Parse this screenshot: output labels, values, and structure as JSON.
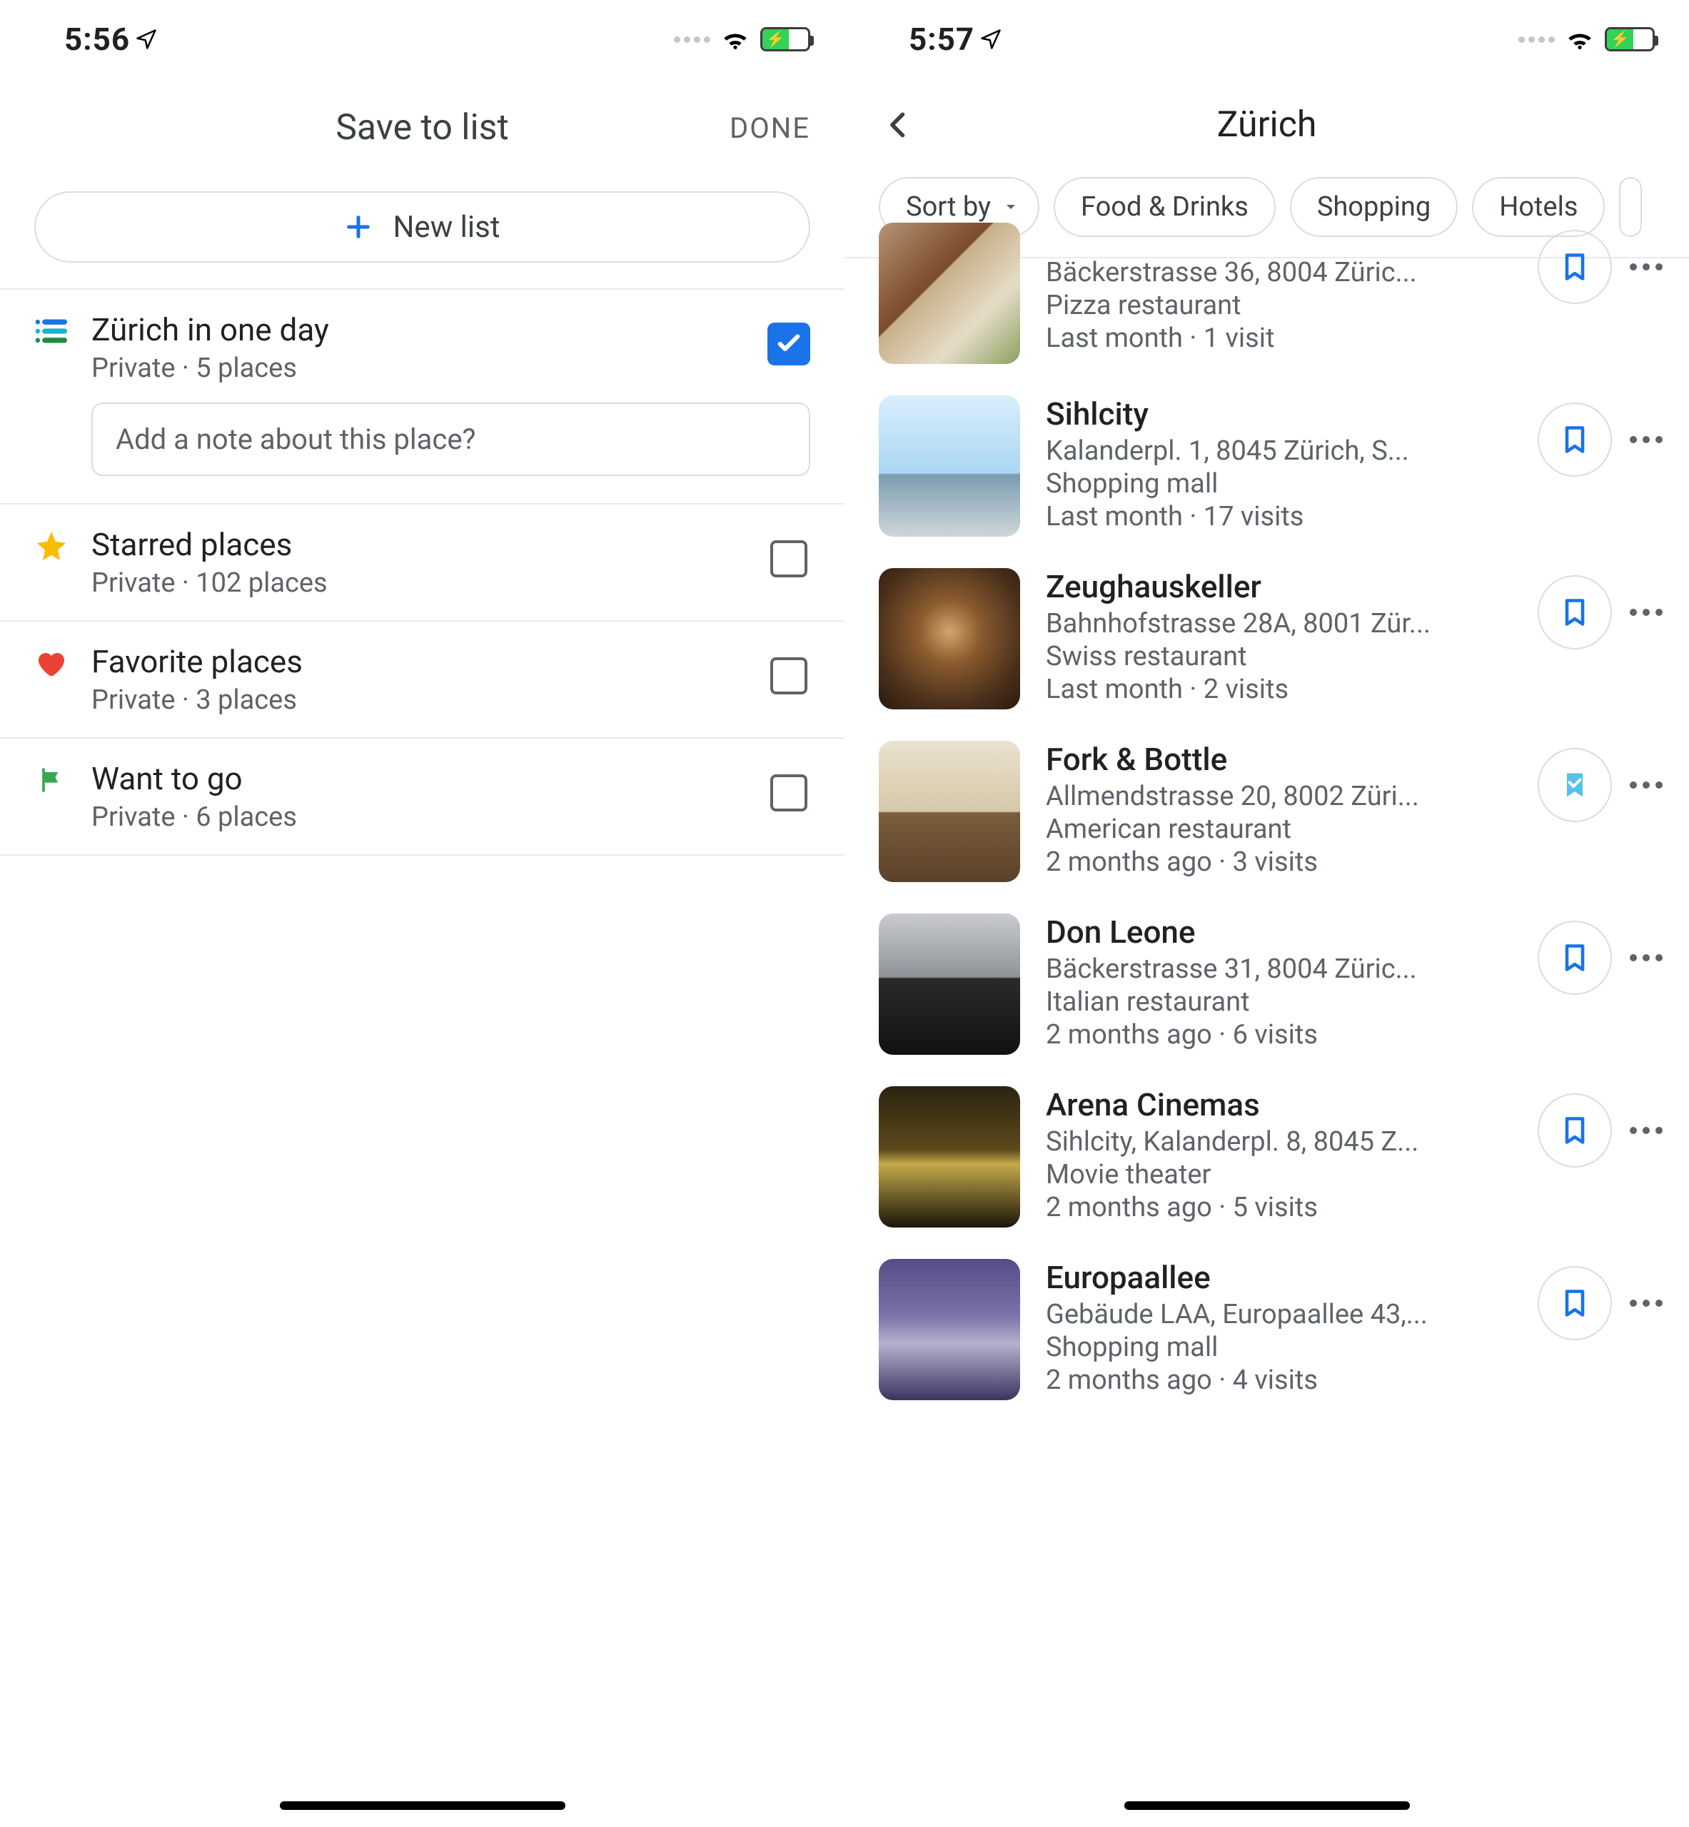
{
  "left": {
    "status": {
      "time": "5:56"
    },
    "header": {
      "title": "Save to list",
      "done": "DONE"
    },
    "newlist_label": "New list",
    "lists": [
      {
        "title": "Zürich in one day",
        "sub": "Private · 5 places",
        "icon": "list-multi",
        "checked": true,
        "note_placeholder": "Add a note about this place?"
      },
      {
        "title": "Starred places",
        "sub": "Private · 102 places",
        "icon": "star",
        "checked": false
      },
      {
        "title": "Favorite places",
        "sub": "Private · 3 places",
        "icon": "heart",
        "checked": false
      },
      {
        "title": "Want to go",
        "sub": "Private · 6 places",
        "icon": "flag",
        "checked": false
      }
    ]
  },
  "right": {
    "status": {
      "time": "5:57"
    },
    "header": {
      "title": "Zürich"
    },
    "chips": {
      "sort": "Sort by",
      "food": "Food & Drinks",
      "shopping": "Shopping",
      "hotels": "Hotels"
    },
    "places": [
      {
        "name_hidden": true,
        "addr": "Bäckerstrasse 36, 8004 Züric...",
        "cat": "Pizza restaurant",
        "meta": "Last month · 1 visit",
        "thumb": "thumb-food1",
        "saved": false
      },
      {
        "name": "Sihlcity",
        "addr": "Kalanderpl. 1, 8045 Zürich, S...",
        "cat": "Shopping mall",
        "meta": "Last month · 17 visits",
        "thumb": "thumb-mall",
        "saved": false
      },
      {
        "name": "Zeughauskeller",
        "addr": "Bahnhofstrasse 28A, 8001 Zür...",
        "cat": "Swiss restaurant",
        "meta": "Last month · 2 visits",
        "thumb": "thumb-rest",
        "saved": false
      },
      {
        "name": "Fork & Bottle",
        "addr": "Allmendstrasse 20, 8002 Züri...",
        "cat": "American restaurant",
        "meta": "2 months ago · 3 visits",
        "thumb": "thumb-tables",
        "saved": true
      },
      {
        "name": "Don Leone",
        "addr": "Bäckerstrasse 31, 8004 Züric...",
        "cat": "Italian restaurant",
        "meta": "2 months ago · 6 visits",
        "thumb": "thumb-cafe",
        "saved": false
      },
      {
        "name": "Arena Cinemas",
        "addr": "Sihlcity, Kalanderpl. 8, 8045 Z...",
        "cat": "Movie theater",
        "meta": "2 months ago · 5 visits",
        "thumb": "thumb-cinema",
        "saved": false
      },
      {
        "name": "Europaallee",
        "addr": "Gebäude LAA, Europaallee 43,...",
        "cat": "Shopping mall",
        "meta": "2 months ago · 4 visits",
        "thumb": "thumb-hall",
        "saved": false
      }
    ]
  }
}
